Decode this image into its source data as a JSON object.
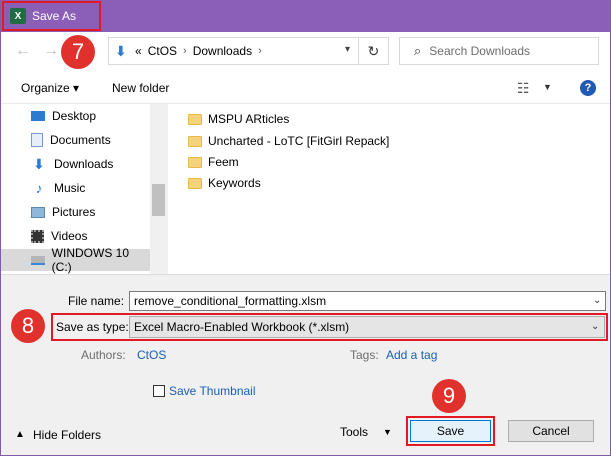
{
  "window": {
    "title": "Save As",
    "app_icon": "excel-icon"
  },
  "address": {
    "chevrons": "«",
    "segments": [
      "CtOS",
      "Downloads"
    ],
    "search_placeholder": "Search Downloads"
  },
  "toolbar": {
    "organize": "Organize ▾",
    "new_folder": "New folder",
    "help": "?"
  },
  "nav_items": [
    {
      "label": "Desktop",
      "icon": "desktop-icon"
    },
    {
      "label": "Documents",
      "icon": "documents-icon"
    },
    {
      "label": "Downloads",
      "icon": "downloads-icon"
    },
    {
      "label": "Music",
      "icon": "music-icon"
    },
    {
      "label": "Pictures",
      "icon": "pictures-icon"
    },
    {
      "label": "Videos",
      "icon": "videos-icon"
    },
    {
      "label": "WINDOWS 10 (C:)",
      "icon": "drive-icon"
    }
  ],
  "files": [
    {
      "name": "MSPU ARticles"
    },
    {
      "name": "Uncharted - LoTC [FitGirl Repack]"
    },
    {
      "name": "Feem"
    },
    {
      "name": "Keywords"
    }
  ],
  "form": {
    "file_name_label": "File name:",
    "file_name_value": "remove_conditional_formatting.xlsm",
    "save_as_type_label": "Save as type:",
    "save_as_type_value": "Excel Macro-Enabled Workbook (*.xlsm)",
    "authors_label": "Authors:",
    "authors_value": "CtOS",
    "tags_label": "Tags:",
    "tags_value": "Add a tag",
    "save_thumbnail": "Save Thumbnail"
  },
  "footer": {
    "hide_folders": "Hide Folders",
    "tools": "Tools",
    "save": "Save",
    "cancel": "Cancel"
  },
  "badges": {
    "b7": "7",
    "b8": "8",
    "b9": "9"
  }
}
